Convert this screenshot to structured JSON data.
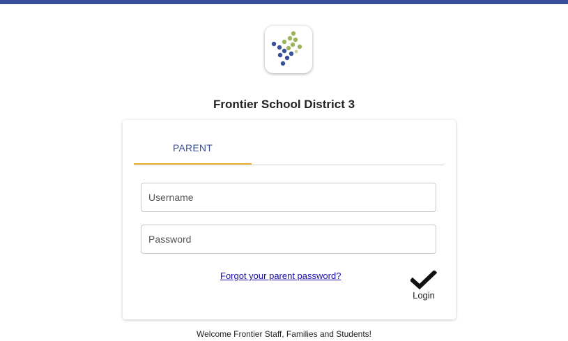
{
  "header": {
    "district_name": "Frontier School District 3"
  },
  "login_card": {
    "tabs": [
      {
        "label": "PARENT",
        "active": true
      }
    ],
    "username": {
      "placeholder": "Username",
      "value": ""
    },
    "password": {
      "placeholder": "Password",
      "value": ""
    },
    "forgot_link": "Forgot your parent password?",
    "login_label": "Login"
  },
  "footer": {
    "welcome": "Welcome Frontier Staff, Families and Students!"
  },
  "colors": {
    "brand_blue": "#3a4f9a",
    "logo_green": "#9db55a",
    "tab_underline": "#f0b23a",
    "link": "#1a0dab"
  },
  "icons": {
    "logo": "dot-grid-logo-icon",
    "login": "checkmark-icon"
  }
}
